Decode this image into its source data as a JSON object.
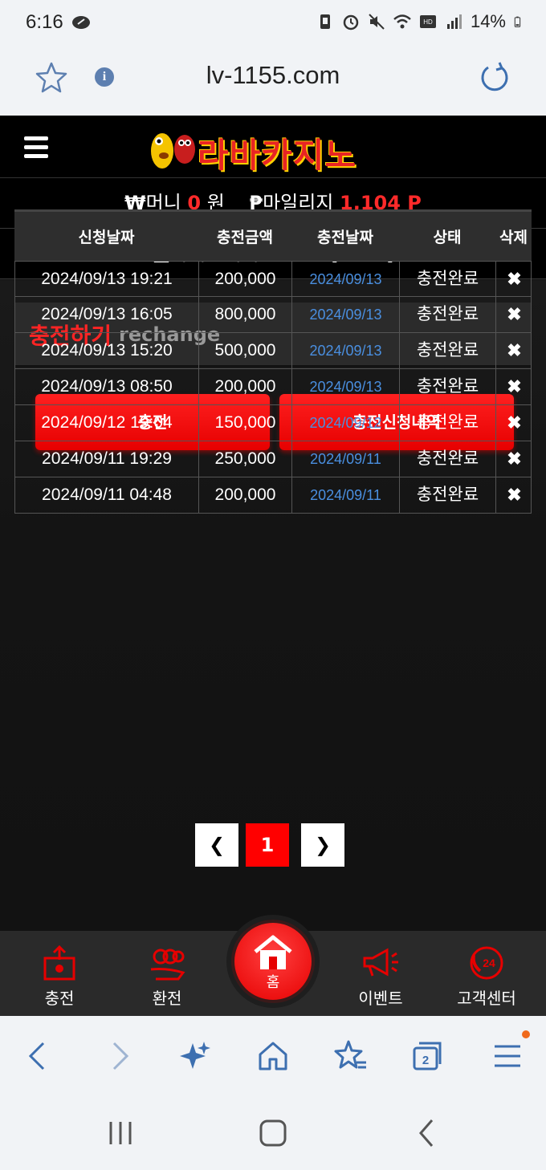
{
  "status_bar": {
    "time": "6:16",
    "battery": "14%"
  },
  "browser": {
    "url": "lv-1155.com",
    "tab_count": "2"
  },
  "site": {
    "logo_text": "라바카지노",
    "money_label": "머니",
    "money_value": "0",
    "money_unit": "원",
    "mileage_label": "마일리지",
    "mileage_value": "1,104 P",
    "casino_label": "카지노머니",
    "casino_value": "0",
    "casino_unit": "원",
    "convert_label": "[ 전환 ]"
  },
  "section": {
    "title_ko": "충전하기",
    "title_en": "rechange"
  },
  "buttons": {
    "charge": "충전",
    "history": "충전신청내역"
  },
  "table": {
    "headers": [
      "신청날짜",
      "충전금액",
      "충전날짜",
      "상태",
      "삭제"
    ],
    "rows": [
      {
        "requested": "2024/09/13 19:21",
        "amount": "200,000",
        "date": "2024/09/13",
        "status": "충전완료",
        "delete": "✖"
      },
      {
        "requested": "2024/09/13 16:05",
        "amount": "800,000",
        "date": "2024/09/13",
        "status": "충전완료",
        "delete": "✖"
      },
      {
        "requested": "2024/09/13 15:20",
        "amount": "500,000",
        "date": "2024/09/13",
        "status": "충전완료",
        "delete": "✖"
      },
      {
        "requested": "2024/09/13 08:50",
        "amount": "200,000",
        "date": "2024/09/13",
        "status": "충전완료",
        "delete": "✖"
      },
      {
        "requested": "2024/09/12 19:04",
        "amount": "150,000",
        "date": "2024/09/12",
        "status": "충전완료",
        "delete": "✖"
      },
      {
        "requested": "2024/09/11 19:29",
        "amount": "250,000",
        "date": "2024/09/11",
        "status": "충전완료",
        "delete": "✖"
      },
      {
        "requested": "2024/09/11 04:48",
        "amount": "200,000",
        "date": "2024/09/11",
        "status": "충전완료",
        "delete": "✖"
      }
    ]
  },
  "pagination": {
    "prev": "❮",
    "current": "1",
    "next": "❯"
  },
  "site_nav": {
    "charge": "충전",
    "exchange": "환전",
    "home": "홈",
    "event": "이벤트",
    "support": "고객센터"
  },
  "colors": {
    "accent": "#ff0000",
    "link": "#4a8fe0"
  }
}
